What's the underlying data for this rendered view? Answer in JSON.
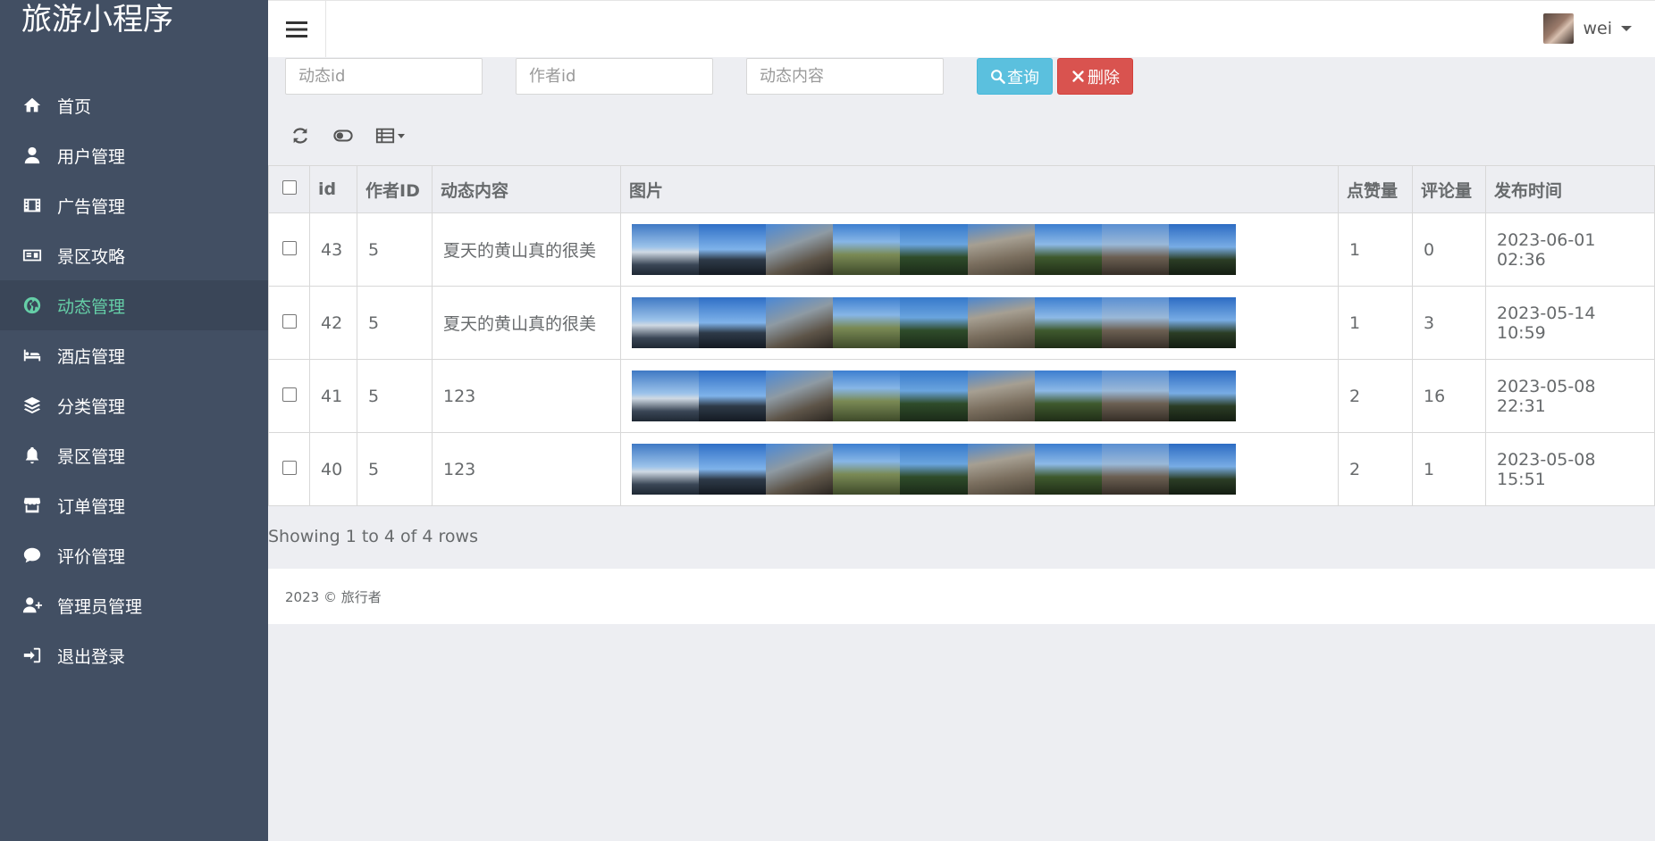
{
  "app": {
    "title": "旅游小程序"
  },
  "sidebar": {
    "items": [
      {
        "label": "首页",
        "icon": "home-icon"
      },
      {
        "label": "用户管理",
        "icon": "user-icon"
      },
      {
        "label": "广告管理",
        "icon": "film-icon"
      },
      {
        "label": "景区攻略",
        "icon": "id-card-icon"
      },
      {
        "label": "动态管理",
        "icon": "globe-icon",
        "active": true
      },
      {
        "label": "酒店管理",
        "icon": "bed-icon"
      },
      {
        "label": "分类管理",
        "icon": "layers-icon"
      },
      {
        "label": "景区管理",
        "icon": "bell-icon"
      },
      {
        "label": "订单管理",
        "icon": "store-icon"
      },
      {
        "label": "评价管理",
        "icon": "comment-icon"
      },
      {
        "label": "管理员管理",
        "icon": "user-plus-icon"
      },
      {
        "label": "退出登录",
        "icon": "sign-in-icon"
      }
    ]
  },
  "header": {
    "user_name": "wei"
  },
  "search": {
    "post_id_placeholder": "动态id",
    "author_id_placeholder": "作者id",
    "content_placeholder": "动态内容",
    "query_label": "查询",
    "delete_label": "删除"
  },
  "table": {
    "columns": [
      "id",
      "作者ID",
      "动态内容",
      "图片",
      "点赞量",
      "评论量",
      "发布时间"
    ],
    "rows": [
      {
        "id": "43",
        "author_id": "5",
        "content": "夏天的黄山真的很美",
        "likes": "1",
        "comments": "0",
        "time": "2023-06-01 02:36"
      },
      {
        "id": "42",
        "author_id": "5",
        "content": "夏天的黄山真的很美",
        "likes": "1",
        "comments": "3",
        "time": "2023-05-14 10:59"
      },
      {
        "id": "41",
        "author_id": "5",
        "content": "123",
        "likes": "2",
        "comments": "16",
        "time": "2023-05-08 22:31"
      },
      {
        "id": "40",
        "author_id": "5",
        "content": "123",
        "likes": "2",
        "comments": "1",
        "time": "2023-05-08 15:51"
      }
    ]
  },
  "pagination": {
    "summary": "Showing 1 to 4 of 4 rows"
  },
  "footer": {
    "text": "2023 © 旅行者"
  },
  "colors": {
    "sidebar_bg": "#424f63",
    "active_text": "#65cea7",
    "info": "#5bc0de",
    "danger": "#d9534f"
  }
}
